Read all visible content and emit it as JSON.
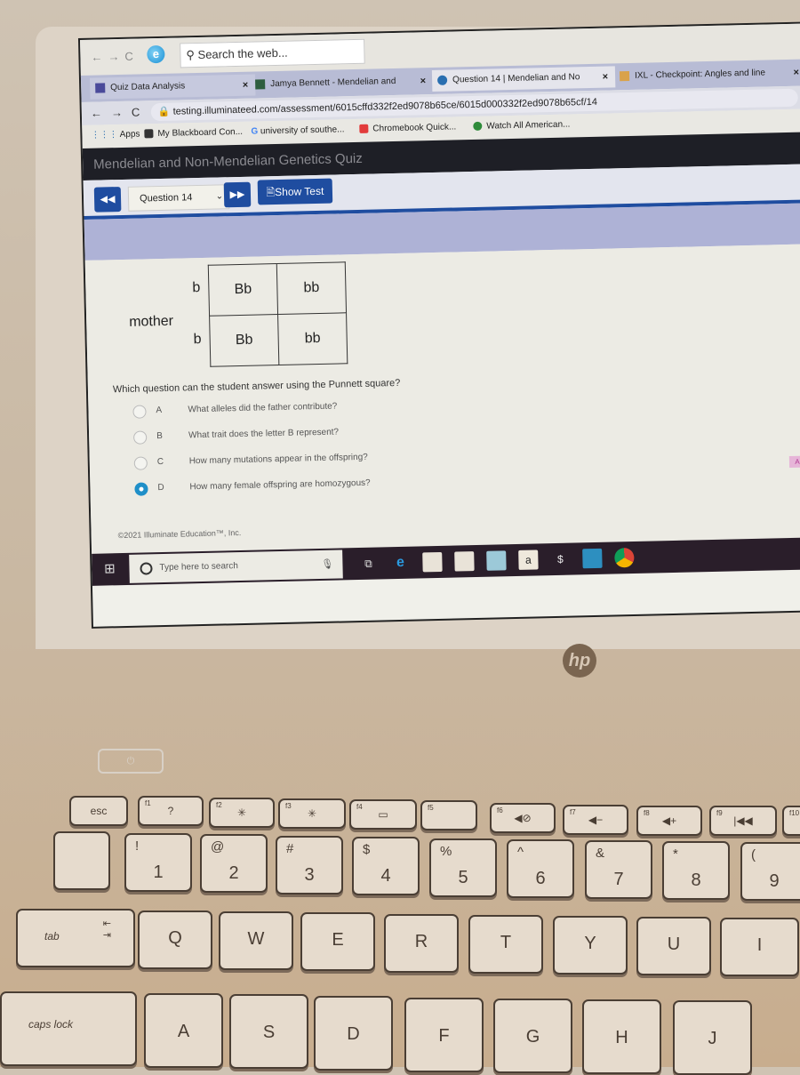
{
  "ie_browser": {
    "search_placeholder": "Search the web..."
  },
  "tabs": [
    {
      "title": "Quiz Data Analysis",
      "close": "×"
    },
    {
      "title": "Jamya Bennett - Mendelian and",
      "close": "×"
    },
    {
      "title": "Question 14 | Mendelian and No",
      "close": "×"
    },
    {
      "title": "IXL - Checkpoint: Angles and line",
      "close": "×"
    }
  ],
  "address_bar": {
    "url": "testing.illuminateed.com/assessment/6015cffd332f2ed9078b65ce/6015d000332f2ed9078b65cf/14",
    "back": "←",
    "forward": "→",
    "reload": "C"
  },
  "bookmarks": [
    {
      "label": "Apps"
    },
    {
      "label": "My Blackboard Con..."
    },
    {
      "label": "university of southe..."
    },
    {
      "label": "Chromebook Quick..."
    },
    {
      "label": "Watch All American..."
    }
  ],
  "quiz": {
    "title": "Mendelian and Non-Mendelian Genetics Quiz",
    "prev_label": "◀◀",
    "question_select": "Question 14",
    "next_label": "▶▶",
    "show_test_label": "Show Test",
    "punnett": {
      "row_label": "mother",
      "row_alleles": [
        "b",
        "b"
      ],
      "cells": [
        [
          "Bb",
          "bb"
        ],
        [
          "Bb",
          "bb"
        ]
      ]
    },
    "question_text": "Which question can the student answer using the Punnett square?",
    "choices": [
      {
        "letter": "A",
        "text": "What alleles did the father contribute?",
        "selected": false
      },
      {
        "letter": "B",
        "text": "What trait does the letter B represent?",
        "selected": false
      },
      {
        "letter": "C",
        "text": "How many mutations appear in the offspring?",
        "selected": false
      },
      {
        "letter": "D",
        "text": "How many female offspring are homozygous?",
        "selected": true
      }
    ],
    "answers_badge": "Answers",
    "footer": "©2021 Illuminate Education™, Inc."
  },
  "taskbar": {
    "search_placeholder": "Type here to search",
    "icons": [
      "task-view",
      "edge",
      "store",
      "store",
      "file-explorer",
      "amazon",
      "app",
      "mail",
      "chrome"
    ]
  },
  "laptop": {
    "brand": "hp",
    "function_keys": [
      {
        "label": "esc",
        "fn": ""
      },
      {
        "label": "?",
        "fn": "f1"
      },
      {
        "label": "✳",
        "fn": "f2"
      },
      {
        "label": "✳",
        "fn": "f3"
      },
      {
        "label": "▭",
        "fn": "f4"
      },
      {
        "label": "",
        "fn": "f5"
      },
      {
        "label": "◀⊘",
        "fn": "f6"
      },
      {
        "label": "◀−",
        "fn": "f7"
      },
      {
        "label": "◀+",
        "fn": "f8"
      },
      {
        "label": "|◀◀",
        "fn": "f9"
      },
      {
        "label": "",
        "fn": "f10"
      }
    ],
    "number_keys": [
      {
        "main": "1",
        "shift": "!"
      },
      {
        "main": "2",
        "shift": "@"
      },
      {
        "main": "3",
        "shift": "#"
      },
      {
        "main": "4",
        "shift": "$"
      },
      {
        "main": "5",
        "shift": "%"
      },
      {
        "main": "6",
        "shift": "^"
      },
      {
        "main": "7",
        "shift": "&"
      },
      {
        "main": "8",
        "shift": "*"
      },
      {
        "main": "9",
        "shift": "("
      }
    ],
    "qwerty_row": [
      "tab",
      "Q",
      "W",
      "E",
      "R",
      "T",
      "Y",
      "U",
      "I"
    ],
    "home_row": [
      "caps lock",
      "A",
      "S",
      "D",
      "F",
      "G",
      "H",
      "J"
    ]
  }
}
